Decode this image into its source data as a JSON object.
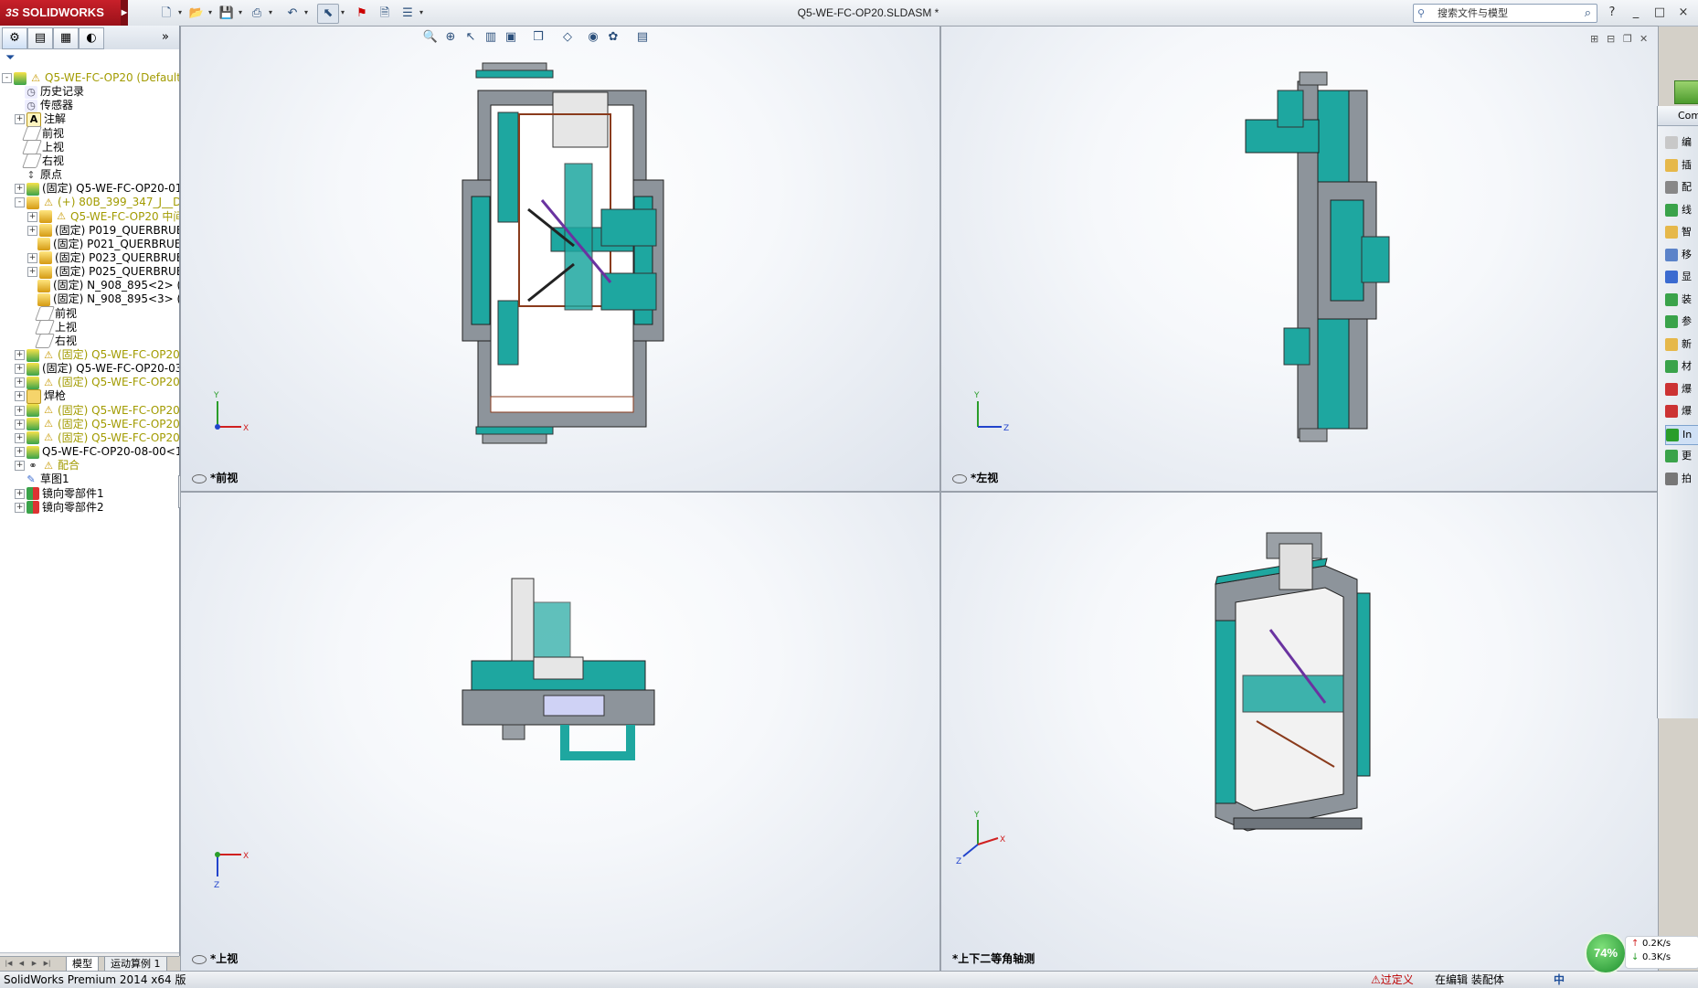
{
  "app": {
    "logo_text": "SOLIDWORKS",
    "logo_prefix": "3S",
    "document_title": "Q5-WE-FC-OP20.SLDASM *",
    "search_placeholder": "搜索文件与模型"
  },
  "toolbar": {
    "icons": [
      "new-icon",
      "open-icon",
      "save-icon",
      "print-icon",
      "undo-icon",
      "select-icon",
      "rebuild-icon",
      "options-icon",
      "file-properties-icon"
    ]
  },
  "window_buttons": [
    "?",
    "_",
    "□",
    "×"
  ],
  "feature_manager": {
    "tabs": [
      "feature-tree-tab",
      "property-tab",
      "configuration-tab",
      "display-tab"
    ],
    "expand_label": "»",
    "tree": [
      {
        "label": "Q5-WE-FC-OP20  (Default<",
        "depth": 0,
        "icon": "asm",
        "warn": true,
        "yellow": true,
        "exp": "-"
      },
      {
        "label": "历史记录",
        "depth": 1,
        "icon": "hist",
        "exp": ""
      },
      {
        "label": "传感器",
        "depth": 1,
        "icon": "hist",
        "exp": ""
      },
      {
        "label": "注解",
        "depth": 1,
        "icon": "note",
        "exp": "+"
      },
      {
        "label": "前视",
        "depth": 1,
        "icon": "plane",
        "exp": ""
      },
      {
        "label": "上视",
        "depth": 1,
        "icon": "plane",
        "exp": ""
      },
      {
        "label": "右视",
        "depth": 1,
        "icon": "plane",
        "exp": ""
      },
      {
        "label": "原点",
        "depth": 1,
        "icon": "origin",
        "exp": ""
      },
      {
        "label": "(固定) Q5-WE-FC-OP20-01-",
        "depth": 1,
        "icon": "asm",
        "exp": "+"
      },
      {
        "label": "(+) 80B_399_347_J__DM",
        "depth": 1,
        "icon": "part",
        "warn": true,
        "yellow": true,
        "exp": "-"
      },
      {
        "label": "Q5-WE-FC-OP20 中间",
        "depth": 2,
        "icon": "part",
        "warn": true,
        "yellow": true,
        "exp": "+"
      },
      {
        "label": "(固定) P019_QUERBRUE",
        "depth": 2,
        "icon": "part",
        "exp": "+"
      },
      {
        "label": "(固定) P021_QUERBRUE",
        "depth": 2,
        "icon": "part",
        "exp": ""
      },
      {
        "label": "(固定) P023_QUERBRUE",
        "depth": 2,
        "icon": "part",
        "exp": "+"
      },
      {
        "label": "(固定) P025_QUERBRUE",
        "depth": 2,
        "icon": "part",
        "exp": "+"
      },
      {
        "label": "(固定) N_908_895<2> (",
        "depth": 2,
        "icon": "part",
        "exp": ""
      },
      {
        "label": "(固定) N_908_895<3> (",
        "depth": 2,
        "icon": "part",
        "exp": ""
      },
      {
        "label": "前视",
        "depth": 2,
        "icon": "plane",
        "exp": ""
      },
      {
        "label": "上视",
        "depth": 2,
        "icon": "plane",
        "exp": ""
      },
      {
        "label": "右视",
        "depth": 2,
        "icon": "plane",
        "exp": ""
      },
      {
        "label": "(固定) Q5-WE-FC-OP20-",
        "depth": 1,
        "icon": "asm",
        "warn": true,
        "yellow": true,
        "exp": "+"
      },
      {
        "label": "(固定) Q5-WE-FC-OP20-03-",
        "depth": 1,
        "icon": "asm",
        "exp": "+"
      },
      {
        "label": "(固定) Q5-WE-FC-OP20-",
        "depth": 1,
        "icon": "asm",
        "warn": true,
        "yellow": true,
        "exp": "+"
      },
      {
        "label": "焊枪",
        "depth": 1,
        "icon": "folder",
        "exp": "+"
      },
      {
        "label": "(固定) Q5-WE-FC-OP20-",
        "depth": 1,
        "icon": "asm",
        "warn": true,
        "yellow": true,
        "exp": "+"
      },
      {
        "label": "(固定) Q5-WE-FC-OP20-",
        "depth": 1,
        "icon": "asm",
        "warn": true,
        "yellow": true,
        "exp": "+"
      },
      {
        "label": "(固定) Q5-WE-FC-OP20-",
        "depth": 1,
        "icon": "asm",
        "warn": true,
        "yellow": true,
        "exp": "+"
      },
      {
        "label": "Q5-WE-FC-OP20-08-00<1>",
        "depth": 1,
        "icon": "asm",
        "exp": "+"
      },
      {
        "label": "配合",
        "depth": 1,
        "icon": "mate",
        "warn": true,
        "yellow": true,
        "exp": "+"
      },
      {
        "label": "草图1",
        "depth": 1,
        "icon": "sketch",
        "exp": ""
      },
      {
        "label": "镜向零部件1",
        "depth": 1,
        "icon": "mirror",
        "exp": "+"
      },
      {
        "label": "镜向零部件2",
        "depth": 1,
        "icon": "mirror",
        "exp": "+"
      }
    ],
    "scroll_thumb_label": "III",
    "bottom_tabs": [
      "模型",
      "运动算例 1"
    ]
  },
  "viewports": [
    {
      "label": "*前视",
      "axes": [
        "Y",
        "X"
      ]
    },
    {
      "label": "*左视",
      "axes": [
        "Y",
        "Z"
      ]
    },
    {
      "label": "*上视",
      "axes": [
        "Z",
        "X"
      ]
    },
    {
      "label": "*上下二等角轴测",
      "axes": [
        "Y",
        "X",
        "Z"
      ]
    }
  ],
  "task_pane": {
    "header": "Com",
    "items": [
      "编",
      "插",
      "配",
      "线",
      "智",
      "移",
      "显",
      "装",
      "参",
      "新",
      "材",
      "爆",
      "爆",
      "In",
      "更",
      "拍"
    ],
    "active_index": 13
  },
  "status_bar": {
    "version": "SolidWorks Premium 2014 x64 版",
    "under_defined": "过定义",
    "editing": "在编辑 装配体",
    "ime": "中"
  },
  "net_widget": {
    "percent": "74%",
    "up": "0.2K/s",
    "down": "0.3K/s"
  },
  "colors": {
    "teal": "#1ea7a0",
    "frame_gray": "#8d949b",
    "brand_red": "#c8202a"
  }
}
